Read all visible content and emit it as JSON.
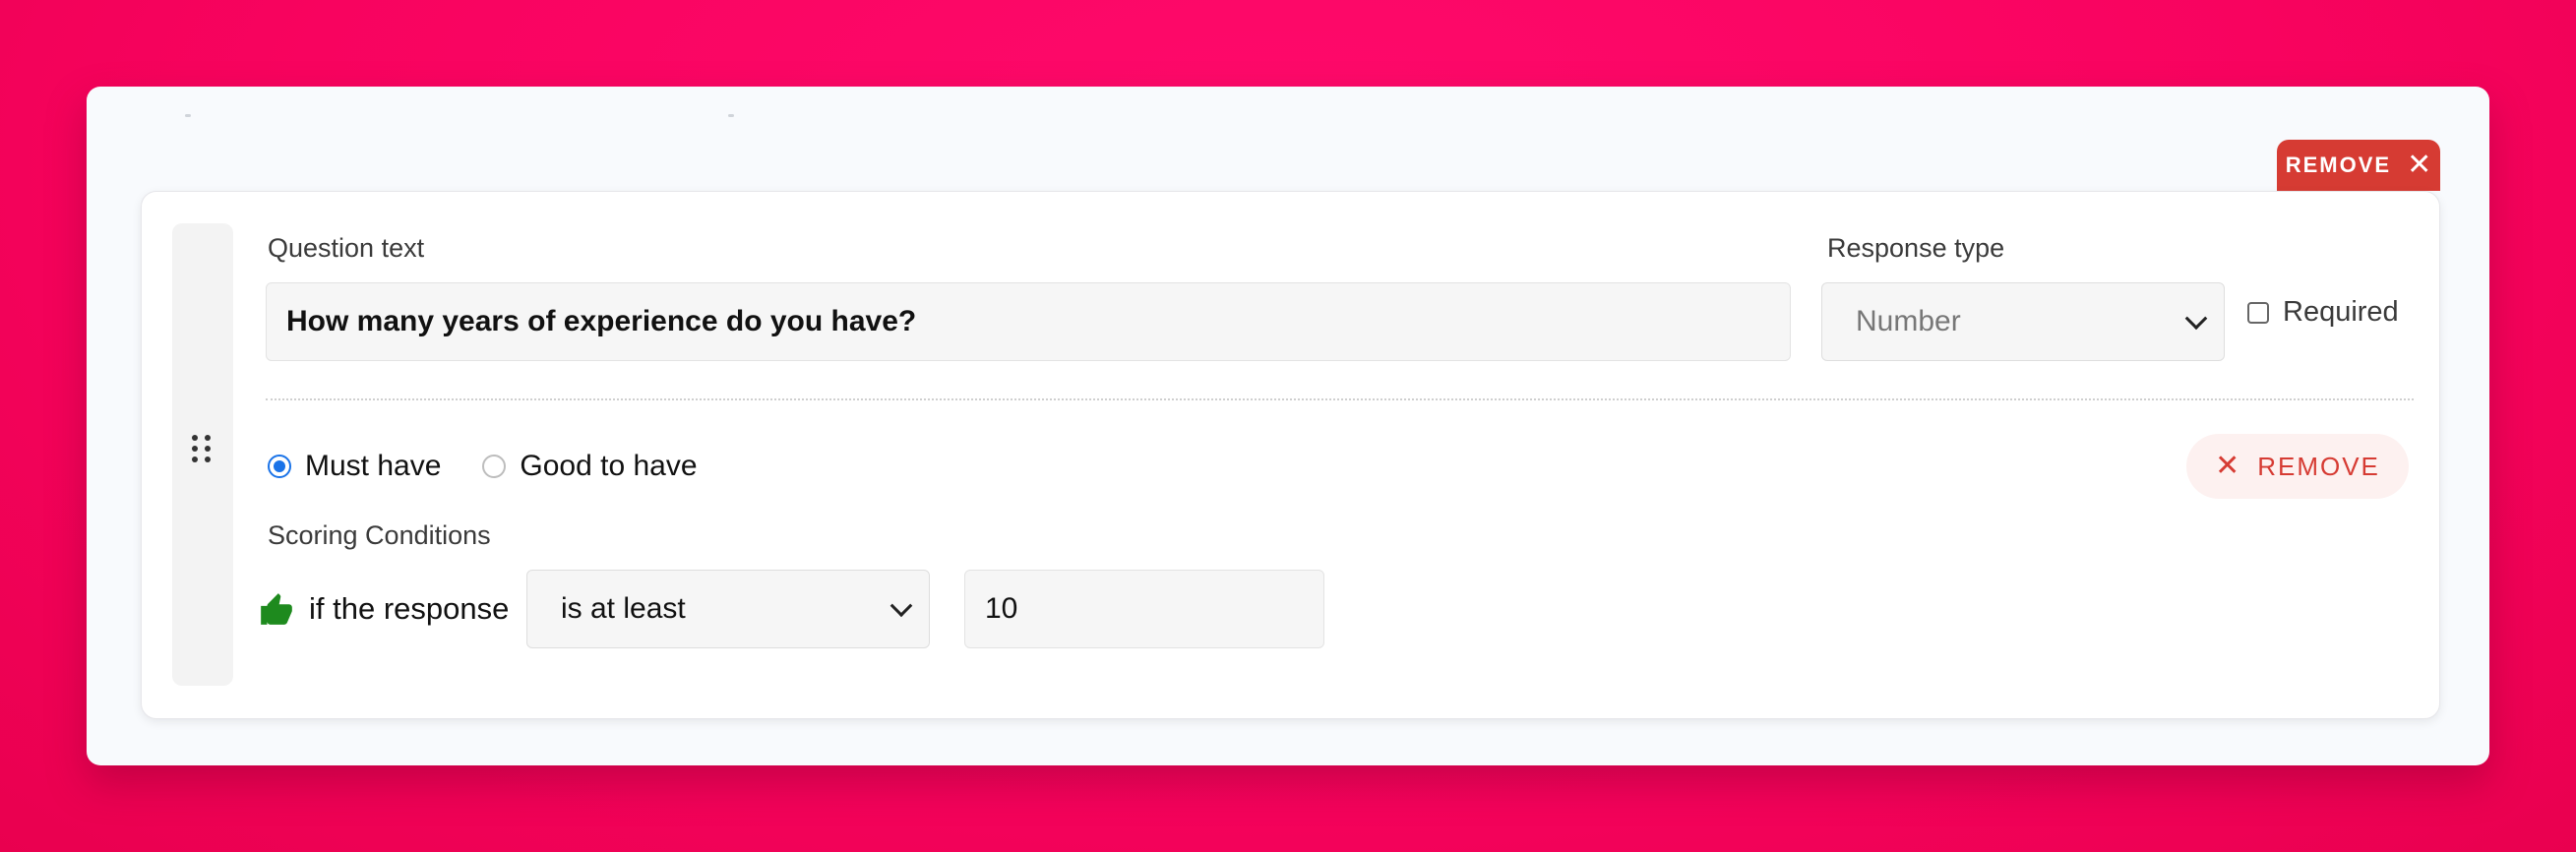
{
  "colors": {
    "background_accent": "#f8035f",
    "remove_red": "#d63b33",
    "radio_blue": "#1a73e8",
    "thumb_green": "#1e8a1e"
  },
  "question": {
    "label": "Question text",
    "value": "How many years of experience do you have?"
  },
  "response_type": {
    "label": "Response type",
    "selected": "Number"
  },
  "required": {
    "label": "Required",
    "checked": false
  },
  "card_remove": {
    "label": "REMOVE",
    "icon": "close-icon"
  },
  "priority": {
    "options": [
      {
        "label": "Must have",
        "selected": true
      },
      {
        "label": "Good to have",
        "selected": false
      }
    ]
  },
  "condition_remove": {
    "label": "REMOVE",
    "icon": "close-icon"
  },
  "scoring": {
    "label": "Scoring Conditions",
    "prefix": "if the response",
    "operator": "is at least",
    "value": "10",
    "icon": "thumbs-up-icon"
  }
}
